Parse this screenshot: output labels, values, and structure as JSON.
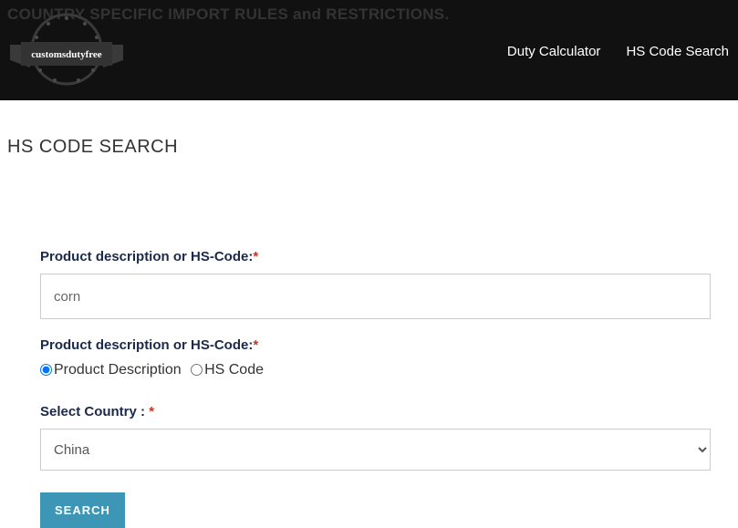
{
  "header": {
    "banner_text": "COUNTRY SPECIFIC IMPORT RULES and RESTRICTIONS.",
    "logo_text": "customsdutyfree",
    "nav": {
      "duty_calculator": "Duty Calculator",
      "hs_code_search": "HS Code Search"
    }
  },
  "page_title": "HS CODE SEARCH",
  "form": {
    "label1": "Product description or HS-Code:",
    "input_value": "corn",
    "label2": "Product description or HS-Code:",
    "radio_product_description": "Product Description",
    "radio_hs_code": "HS Code",
    "label_country": "Select Country : ",
    "country_selected": "China",
    "search_button": "SEARCH",
    "required_mark": "*"
  }
}
